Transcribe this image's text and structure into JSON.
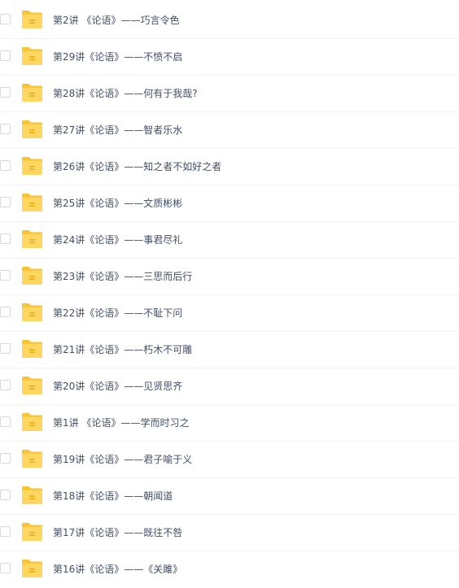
{
  "colors": {
    "folder_back": "#f9c433",
    "folder_front": "#ffd760",
    "folder_badge": "#f2b21e",
    "text": "#424e67",
    "divider": "#f1f2f4"
  },
  "files": [
    {
      "name": "第2讲 《论语》——巧言令色",
      "icon": "folder-icon"
    },
    {
      "name": "第29讲《论语》——不愤不启",
      "icon": "folder-icon"
    },
    {
      "name": "第28讲《论语》——何有于我哉?",
      "icon": "folder-icon"
    },
    {
      "name": "第27讲《论语》——智者乐水",
      "icon": "folder-icon"
    },
    {
      "name": "第26讲《论语》——知之者不如好之者",
      "icon": "folder-icon"
    },
    {
      "name": "第25讲《论语》——文质彬彬",
      "icon": "folder-icon"
    },
    {
      "name": "第24讲《论语》——事君尽礼",
      "icon": "folder-icon"
    },
    {
      "name": "第23讲《论语》——三思而后行",
      "icon": "folder-icon"
    },
    {
      "name": "第22讲《论语》——不耻下问",
      "icon": "folder-icon"
    },
    {
      "name": "第21讲《论语》——朽木不可雕",
      "icon": "folder-icon"
    },
    {
      "name": "第20讲《论语》——见贤思齐",
      "icon": "folder-icon"
    },
    {
      "name": "第1讲 《论语》——学而时习之",
      "icon": "folder-icon"
    },
    {
      "name": "第19讲《论语》——君子喻于义",
      "icon": "folder-icon"
    },
    {
      "name": "第18讲《论语》——朝闻道",
      "icon": "folder-icon"
    },
    {
      "name": "第17讲《论语》——既往不咎",
      "icon": "folder-icon"
    },
    {
      "name": "第16讲《论语》——《关雎》",
      "icon": "folder-icon"
    }
  ]
}
